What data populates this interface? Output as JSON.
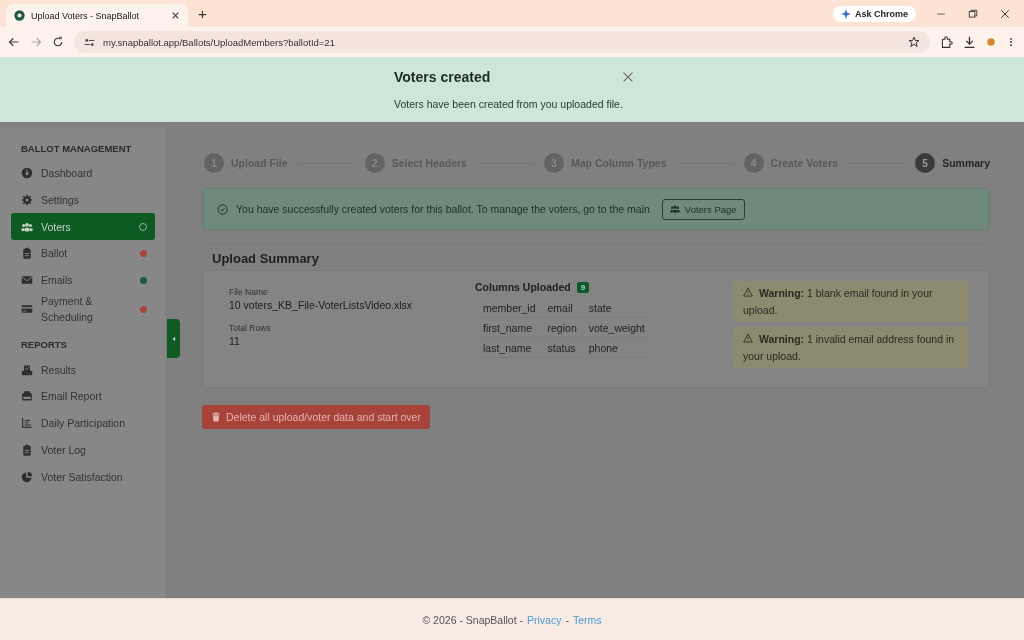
{
  "browser": {
    "tab_title": "Upload Voters - SnapBallot",
    "new_tab": "+",
    "ask_chrome": "Ask Chrome",
    "url": "my.snapballot.app/Ballots/UploadMembers?ballotId=21"
  },
  "toast": {
    "title": "Voters created",
    "message": "Voters have been created from you uploaded file."
  },
  "sidebar": {
    "sections": [
      {
        "heading": "BALLOT MANAGEMENT",
        "items": [
          {
            "label": "Dashboard",
            "kind": "dashboard",
            "selected": false
          },
          {
            "label": "Settings",
            "kind": "settings",
            "selected": false
          },
          {
            "label": "Voters",
            "kind": "voters",
            "selected": true,
            "marker": {
              "kind": "ring"
            }
          },
          {
            "label": "Ballot",
            "kind": "ballot",
            "selected": false,
            "marker": {
              "kind": "dot",
              "color": "#a8453f"
            }
          },
          {
            "label": "Emails",
            "kind": "emails",
            "selected": false,
            "marker": {
              "kind": "dot",
              "color": "#1d5a38"
            }
          },
          {
            "label": "Payment & Scheduling",
            "kind": "payment",
            "selected": false,
            "marker": {
              "kind": "dot",
              "color": "#a8453f"
            }
          }
        ]
      },
      {
        "heading": "REPORTS",
        "items": [
          {
            "label": "Results",
            "kind": "results",
            "selected": false
          },
          {
            "label": "Email Report",
            "kind": "report",
            "selected": false
          },
          {
            "label": "Daily Participation",
            "kind": "participation",
            "selected": false
          },
          {
            "label": "Voter Log",
            "kind": "log",
            "selected": false
          },
          {
            "label": "Voter Satisfaction",
            "kind": "satisfaction",
            "selected": false
          }
        ]
      }
    ]
  },
  "steps": [
    {
      "number": "1",
      "label": "Upload File",
      "selected": false
    },
    {
      "number": "2",
      "label": "Select Headers",
      "selected": false
    },
    {
      "number": "3",
      "label": "Map Column Types",
      "selected": false
    },
    {
      "number": "4",
      "label": "Create Voters",
      "selected": false
    },
    {
      "number": "5",
      "label": "Summary",
      "selected": true
    }
  ],
  "success_alert": {
    "text": "You have successfully created voters for this ballot. To manage the voters, go to the main",
    "button": "Voters Page"
  },
  "upload_summary": {
    "heading": "Upload Summary",
    "fields": [
      {
        "label": "File Name",
        "value": "10 voters_KB_File-VoterListsVideo.xlsx"
      },
      {
        "label": "Total Rows",
        "value": "11"
      }
    ],
    "columns_title": "Columns Uploaded",
    "columns_count": "9",
    "columns": [
      [
        "member_id",
        "email",
        "state"
      ],
      [
        "first_name",
        "region",
        "vote_weight"
      ],
      [
        "last_name",
        "status",
        "phone"
      ]
    ],
    "warnings": [
      "**Warning:** 1 blank email found in your upload.",
      "**Warning:** 1 invalid email address found in your upload."
    ]
  },
  "delete_button": "Delete all upload/voter data and start over",
  "footer": {
    "text": "© 2026 - SnapBallot -",
    "links": [
      "Privacy",
      "Terms"
    ],
    "separator": "-"
  }
}
